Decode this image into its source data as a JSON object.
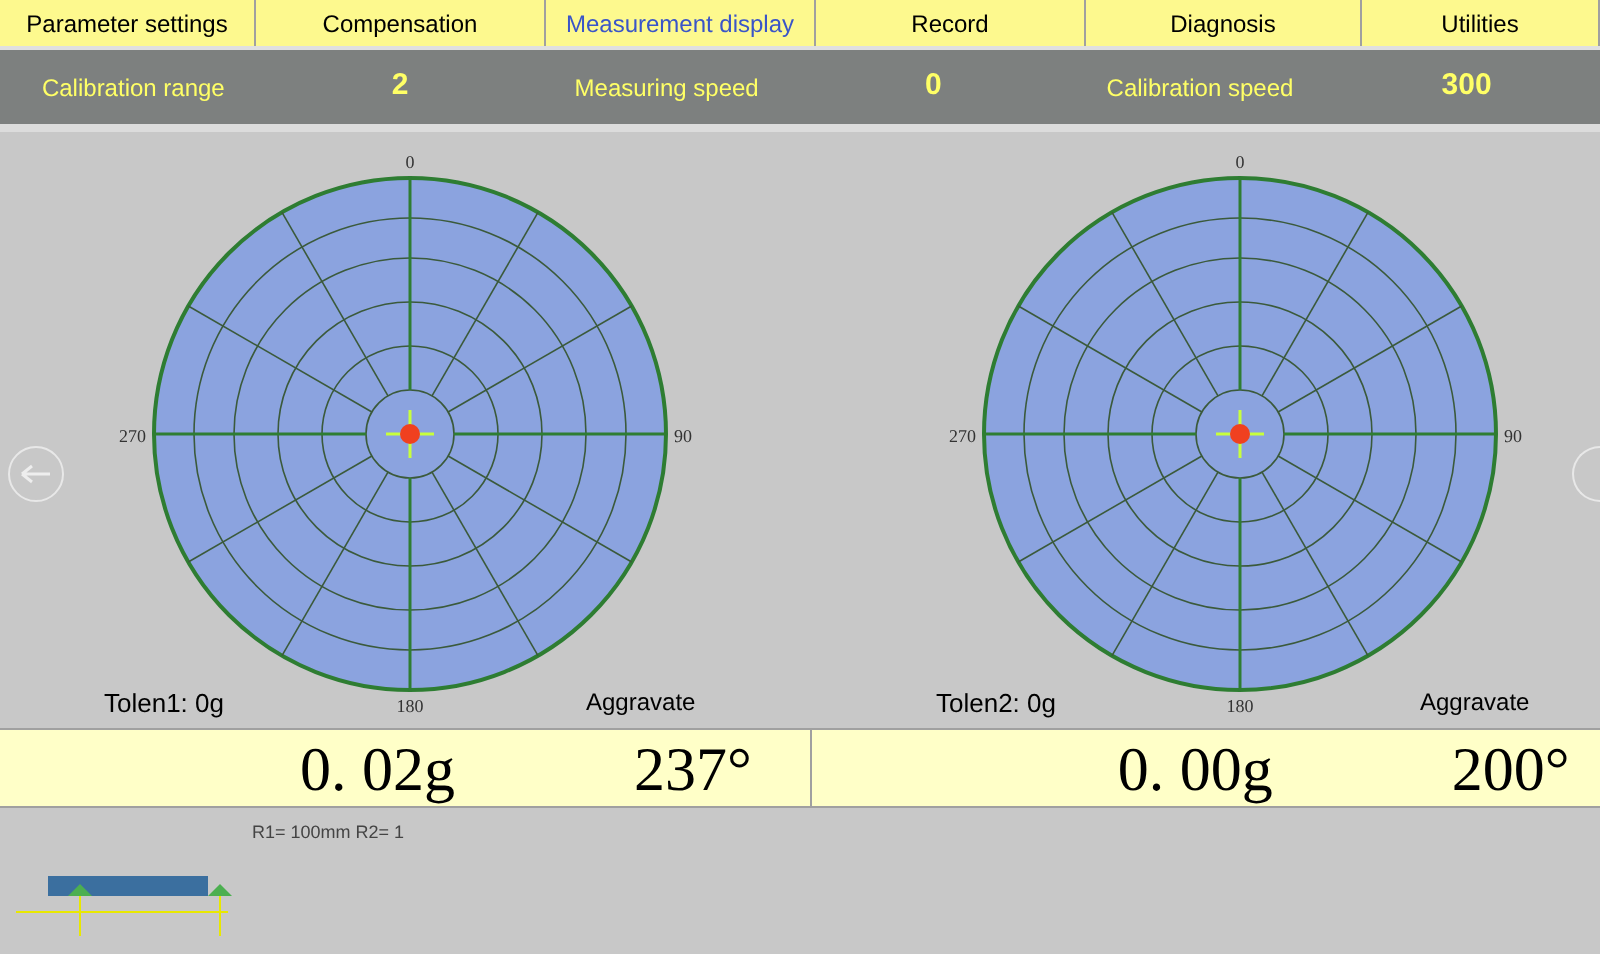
{
  "tabs": [
    {
      "label": "Parameter settings",
      "selected": false
    },
    {
      "label": "Compensation",
      "selected": false
    },
    {
      "label": "Measurement display",
      "selected": true
    },
    {
      "label": "Record",
      "selected": false
    },
    {
      "label": "Diagnosis",
      "selected": false
    },
    {
      "label": "Utilities",
      "selected": false
    }
  ],
  "status": [
    {
      "label": "Calibration range",
      "value": "2"
    },
    {
      "label": "Measuring speed",
      "value": "0"
    },
    {
      "label": "Calibration speed",
      "value": "300"
    }
  ],
  "planes": [
    {
      "angle_labels": [
        "0",
        "90",
        "180",
        "270"
      ],
      "tolerance": "Tolen1: 0g",
      "mode": "Aggravate",
      "mass": "0. 02g",
      "angle": "237°"
    },
    {
      "angle_labels": [
        "0",
        "90",
        "180",
        "270"
      ],
      "tolerance": "Tolen2: 0g",
      "mode": "Aggravate",
      "mass": "0. 00g",
      "angle": "200°"
    }
  ],
  "diagram": {
    "caption": "R1= 100mm   R2= 1"
  }
}
